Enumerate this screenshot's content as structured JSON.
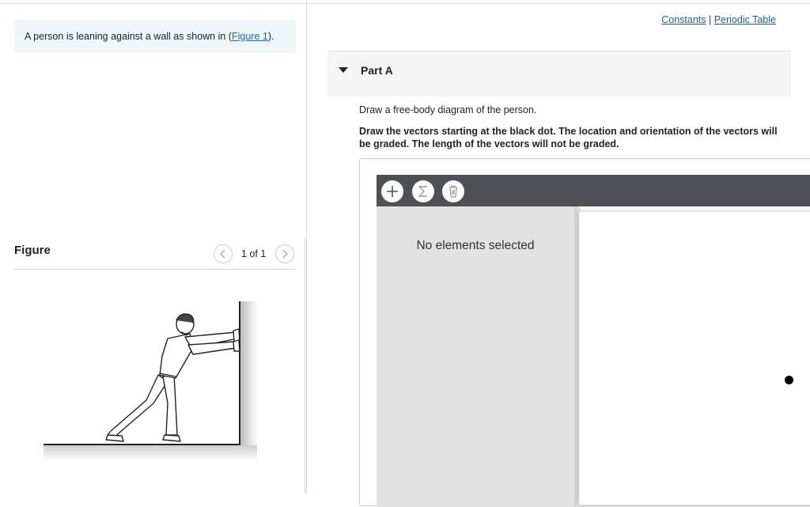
{
  "problem": {
    "text_prefix": "A person is leaning against a wall as shown in (",
    "figure_link": "Figure 1",
    "text_suffix": ")."
  },
  "figure": {
    "title": "Figure",
    "counter": "1 of 1",
    "prev_icon": "chevron-left-icon",
    "next_icon": "chevron-right-icon"
  },
  "links": {
    "constants": "Constants",
    "separator": " | ",
    "periodic_table": "Periodic Table"
  },
  "part": {
    "title": "Part A",
    "instruction": "Draw a free-body diagram of the person.",
    "instruction_bold": "Draw the vectors starting at the black dot. The location and orientation of the vectors will be graded. The length of the vectors will not be graded."
  },
  "tool": {
    "buttons": [
      "plus-icon",
      "sigma-icon",
      "trash-icon"
    ],
    "status": "No elements selected"
  },
  "colors": {
    "accent_link": "#1a6fa3",
    "toolbar": "#4f4f57",
    "problem_bg": "#eef6f9"
  }
}
